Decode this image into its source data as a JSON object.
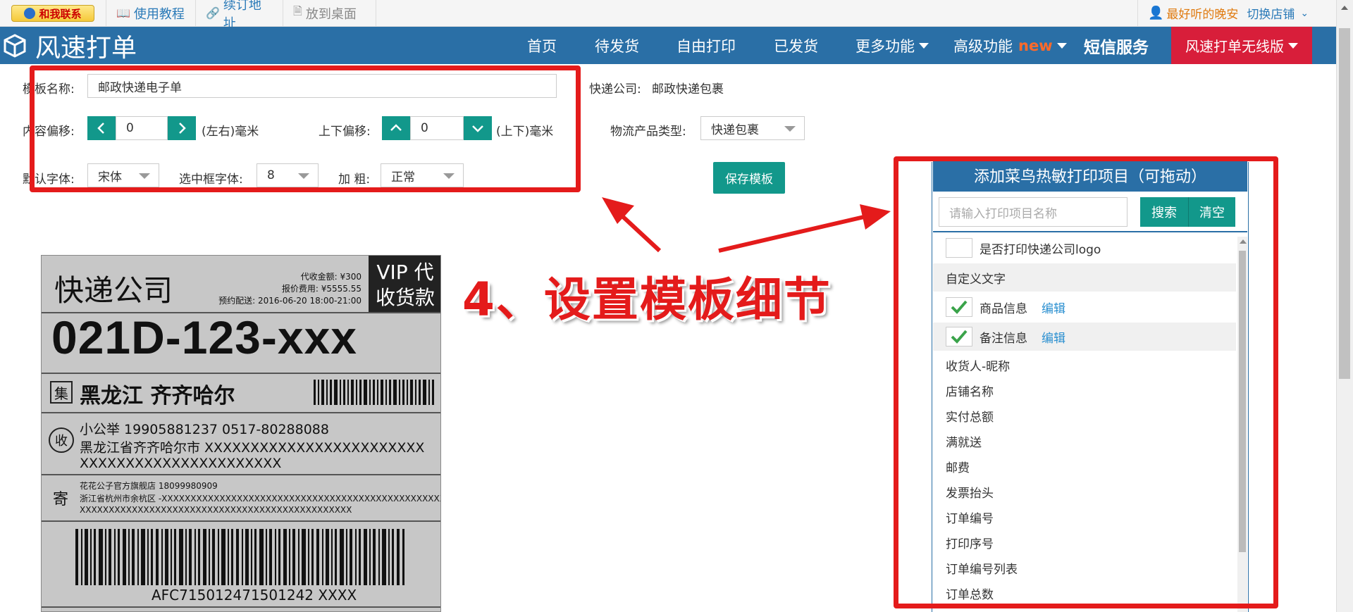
{
  "topbar": {
    "contact_label": "和我联系",
    "tutorial_label": "使用教程",
    "renew_label": "续订地址",
    "desktop_label": "放到桌面",
    "user_name": "最好听的晚安",
    "switch_shop_label": "切换店铺"
  },
  "nav": {
    "logo_text": "风速打单",
    "items": [
      "首页",
      "待发货",
      "自由打印",
      "已发货",
      "更多功能",
      "高级功能",
      "短信服务"
    ],
    "new_badge": "new",
    "wireless_label": "风速打单无线版"
  },
  "form": {
    "template_name_label": "模板名称:",
    "template_name_value": "邮政快递电子单",
    "courier_label": "快递公司:",
    "courier_value": "邮政快递包裹",
    "content_offset_label": "内容偏移:",
    "content_offset_value": "0",
    "lr_unit": "(左右)毫米",
    "vertical_offset_label": "上下偏移:",
    "vertical_offset_value": "0",
    "ud_unit": "(上下)毫米",
    "product_type_label": "物流产品类型:",
    "product_type_value": "快递包裹",
    "default_font_label": "默认字体:",
    "default_font_value": "宋体",
    "selected_font_label": "选中框字体:",
    "selected_font_value": "8",
    "bold_label": "加 粗:",
    "bold_value": "正常",
    "save_label": "保存模板"
  },
  "annotation": {
    "text": "4、设置模板细节"
  },
  "label_preview": {
    "company": "快递公司",
    "cod_amount": "代收金额: ¥300",
    "quote_fee": "报价费用: ¥5555.55",
    "scheduled": "预约配送: 2016-06-20 18:00-21:00",
    "vip_line1": "VIP 代",
    "vip_line2": "收货款",
    "code": "021D-123-xxx",
    "ji": "集",
    "region": "黑龙江 齐齐哈尔",
    "shou": "收",
    "recipient_line": "小公举    19905881237    0517-80288088",
    "recipient_addr1": "黑龙江省齐齐哈尔市 XXXXXXXXXXXXXXXXXXXXXXXX",
    "recipient_addr2": "XXXXXXXXXXXXXXXXXXXXXX",
    "ji2": "寄",
    "sender_line": "花花公子官方旗舰店    18099980909",
    "sender_addr1": "浙江省杭州市余杭区 -XXXXXXXXXXXXXXXXXXXXXXXXXXXXXXXXXXXXXXXXXXXXXXXXXX",
    "sender_addr2": "XXXXXXXXXXXXXXXXXXXXXXXXXXXXXXXXXXXXXXXXXXXXXXX",
    "tracking": "AFC715012471501242 XXXX"
  },
  "panel": {
    "title": "添加菜鸟热敏打印项目（可拖动）",
    "search_placeholder": "请输入打印项目名称",
    "search_label": "搜索",
    "clear_label": "清空",
    "edit_label": "编辑",
    "items": [
      "是否打印快递公司logo",
      "自定义文字",
      "商品信息",
      "备注信息",
      "收货人-昵称",
      "店铺名称",
      "实付总额",
      "满就送",
      "邮费",
      "发票抬头",
      "订单编号",
      "打印序号",
      "订单编号列表",
      "订单总数"
    ]
  }
}
